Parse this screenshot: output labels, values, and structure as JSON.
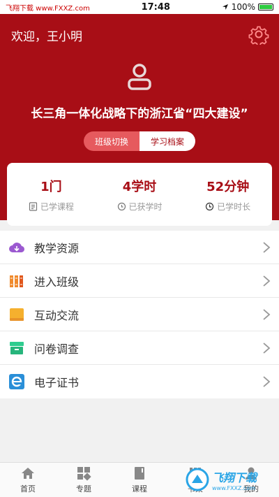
{
  "status_bar": {
    "left_text": "飞翔下载 www.FXXZ.com",
    "time": "17:48",
    "battery": "100%"
  },
  "header": {
    "welcome": "欢迎，王小明",
    "course_title": "长三角一体化战略下的浙江省“四大建设”",
    "switch": {
      "option_1": "班级切换",
      "option_2": "学习档案",
      "selected": "学习档案"
    }
  },
  "stats": [
    {
      "value": "1门",
      "label": "已学课程",
      "icon": "document-icon"
    },
    {
      "value": "4学时",
      "label": "已获学时",
      "icon": "timer-icon"
    },
    {
      "value": "52分钟",
      "label": "已学时长",
      "icon": "clock-icon"
    }
  ],
  "menu": [
    {
      "label": "教学资源",
      "icon": "cloud-download-icon",
      "color": "#9b59d0"
    },
    {
      "label": "进入班级",
      "icon": "books-icon",
      "color": "#f08a2c"
    },
    {
      "label": "互动交流",
      "icon": "book-icon",
      "color": "#f5b02e"
    },
    {
      "label": "问卷调查",
      "icon": "archive-icon",
      "color": "#2ecc8f"
    },
    {
      "label": "电子证书",
      "icon": "ie-icon",
      "color": "#2a8fd8"
    }
  ],
  "tabbar": [
    {
      "label": "首页",
      "icon": "home-icon"
    },
    {
      "label": "专题",
      "icon": "grid-icon"
    },
    {
      "label": "课程",
      "icon": "course-book-icon"
    },
    {
      "label": "书架",
      "icon": "shelf-icon"
    },
    {
      "label": "我的",
      "icon": "user-icon"
    }
  ],
  "watermark": {
    "main": "飞翔下载",
    "sub": "www.FXXZ.com"
  },
  "colors": {
    "brand": "#a80e16",
    "switch_inactive": "#e65a5e"
  }
}
